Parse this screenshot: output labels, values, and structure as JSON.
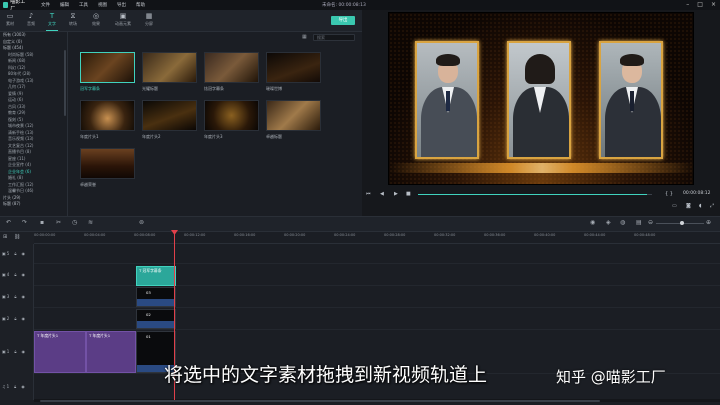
{
  "app": {
    "logo_text": "喵影工厂",
    "menu": [
      "文件",
      "编辑",
      "工具",
      "视图",
      "导出",
      "帮助"
    ],
    "doc_title": "未命名: 00:00:08:13"
  },
  "toolbar": {
    "tabs": [
      {
        "label": "素材",
        "icon": "folder-icon"
      },
      {
        "label": "音频",
        "icon": "music-icon"
      },
      {
        "label": "文字",
        "icon": "text-icon"
      },
      {
        "label": "转场",
        "icon": "transition-icon"
      },
      {
        "label": "效果",
        "icon": "effects-icon"
      },
      {
        "label": "动画元素",
        "icon": "elements-icon"
      },
      {
        "label": "分屏",
        "icon": "split-screen-icon"
      }
    ],
    "active_tab": "文字",
    "export_label": "导出"
  },
  "categories": [
    {
      "label": "所有 (1003)",
      "level": "top"
    },
    {
      "label": "自定义 (0)",
      "level": "top"
    },
    {
      "label": "标题 (454)",
      "level": "top"
    },
    {
      "label": "时尚标题 (58)",
      "level": "sub"
    },
    {
      "label": "新闻 (68)",
      "level": "sub"
    },
    {
      "label": "科幻 (12)",
      "level": "sub"
    },
    {
      "label": "80年代 (28)",
      "level": "sub"
    },
    {
      "label": "电子游戏 (13)",
      "level": "sub"
    },
    {
      "label": "几何 (17)",
      "level": "sub"
    },
    {
      "label": "爱情 (9)",
      "level": "sub"
    },
    {
      "label": "运动 (6)",
      "level": "sub"
    },
    {
      "label": "古风 (33)",
      "level": "sub"
    },
    {
      "label": "教育 (29)",
      "level": "sub"
    },
    {
      "label": "復刻 (5)",
      "level": "sub"
    },
    {
      "label": "城市夜景 (12)",
      "level": "sub"
    },
    {
      "label": "清新手绘 (13)",
      "level": "sub"
    },
    {
      "label": "音乐视频 (13)",
      "level": "sub"
    },
    {
      "label": "文艺复古 (12)",
      "level": "sub"
    },
    {
      "label": "直播节目 (8)",
      "level": "sub"
    },
    {
      "label": "星座 (11)",
      "level": "sub"
    },
    {
      "label": "企业宣传 (4)",
      "level": "sub"
    },
    {
      "label": "企业年会 (6)",
      "level": "sub",
      "active": true
    },
    {
      "label": "婚礼 (8)",
      "level": "sub"
    },
    {
      "label": "工作汇报 (12)",
      "level": "sub"
    },
    {
      "label": "温馨节日 (46)",
      "level": "sub"
    },
    {
      "label": "片头 (29)",
      "level": "top"
    },
    {
      "label": "标题 (87)",
      "level": "top"
    }
  ],
  "search": {
    "placeholder": "搜索"
  },
  "thumbnails": [
    {
      "label": "冠军字幕条",
      "selected": true,
      "bg": "linear-gradient(135deg,#2a1a0a,#6b4420 50%,#1a1008)"
    },
    {
      "label": "光耀标题",
      "selected": false,
      "bg": "linear-gradient(135deg,#3a2a1a,#8a6a3a 55%,#2a1a0a)"
    },
    {
      "label": "炫冠字幕条",
      "selected": false,
      "bg": "linear-gradient(135deg,#3a2a20,#7a5a3a 50%,#201408)"
    },
    {
      "label": "璀璨世博",
      "selected": false,
      "bg": "linear-gradient(160deg,#0c0806,#3a2410 60%,#120a06)"
    },
    {
      "label": "年度片头1",
      "selected": false,
      "bg": "radial-gradient(circle at 50% 60%,#c89050,#3a2410 55%,#0c0804)"
    },
    {
      "label": "年度片头2",
      "selected": false,
      "bg": "linear-gradient(160deg,#0a0806,#4a3010 55%,#0a0604)"
    },
    {
      "label": "年度片头3",
      "selected": false,
      "bg": "radial-gradient(circle at 50% 50%,#8a6020,#2a1808 60%,#0a0604)"
    },
    {
      "label": "卓越标题",
      "selected": false,
      "bg": "linear-gradient(135deg,#3a2818,#a07a4a 50%,#2a1a0a)"
    },
    {
      "label": "卓越荣誉",
      "selected": false,
      "bg": "linear-gradient(180deg,#6a4020,#2a1408 60%,#100804)"
    }
  ],
  "preview": {
    "timecode": "00:00:08:12",
    "progress": 0.98,
    "people": [
      "man-left",
      "woman-center",
      "man-right"
    ]
  },
  "timeline": {
    "ruler": [
      "00:00:00:00",
      "00:00:04:00",
      "00:00:08:00",
      "00:00:12:00",
      "00:00:16:00",
      "00:00:20:00",
      "00:00:24:00",
      "00:00:28:00",
      "00:00:32:00",
      "00:00:36:00",
      "00:00:40:00",
      "00:00:44:00",
      "00:00:48:00"
    ],
    "tracks": [
      {
        "label": "5",
        "clips": []
      },
      {
        "label": "4",
        "clips": [
          {
            "type": "title",
            "caption": "冠军字幕条"
          }
        ]
      },
      {
        "label": "3",
        "clips": [
          {
            "type": "black",
            "caption": "03"
          }
        ]
      },
      {
        "label": "2",
        "clips": [
          {
            "type": "black",
            "caption": "02"
          }
        ]
      },
      {
        "label": "1",
        "clips": [
          {
            "type": "purple",
            "caption": "年度片头1"
          },
          {
            "type": "purple",
            "caption": "年度片头1"
          },
          {
            "type": "black",
            "caption": "01"
          }
        ]
      },
      {
        "label": "1",
        "clips": []
      }
    ]
  },
  "overlay": {
    "subtitle": "将选中的文字素材拖拽到新视频轨道上",
    "watermark": "知乎 @喵影工厂"
  }
}
